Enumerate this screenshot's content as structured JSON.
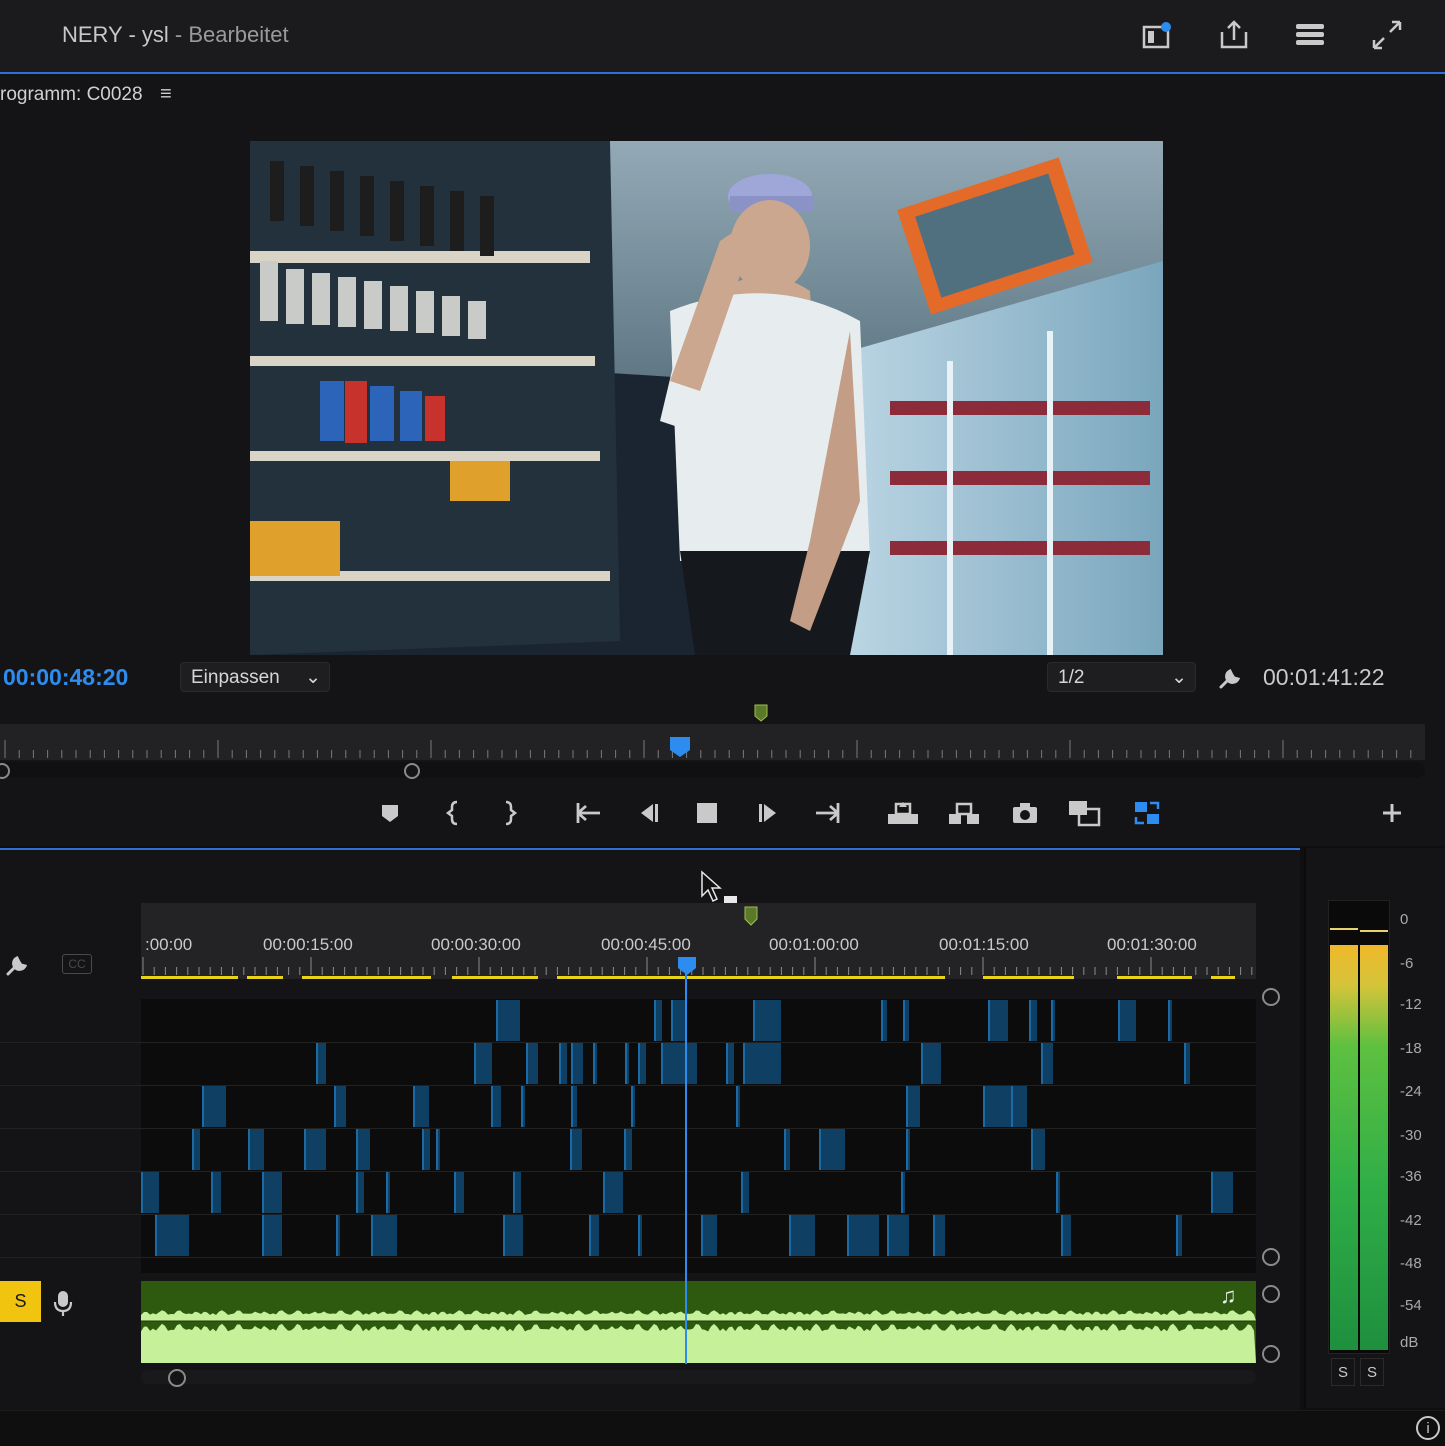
{
  "header": {
    "project": "NERY - ysl",
    "status": " - Bearbeitet",
    "icons": [
      "workspace-icon",
      "export-icon",
      "layout-icon",
      "fullscreen-icon"
    ]
  },
  "program": {
    "tab_label": "rogramm: C0028",
    "menu_glyph": "≡",
    "current_timecode": "00:00:48:20",
    "fit_label": "Einpassen",
    "resolution_label": "1/2",
    "duration_timecode": "00:01:41:22"
  },
  "timeline": {
    "ruler_labels": [
      ":00:00",
      "00:00:15:00",
      "00:00:30:00",
      "00:00:45:00",
      "00:01:00:00",
      "00:01:15:00",
      "00:01:30:00"
    ],
    "cc_label": "CC",
    "solo_label": "S",
    "music_glyph": "♫",
    "playhead_fraction": 0.489
  },
  "meters": {
    "scale": [
      "0",
      "-6",
      "-12",
      "-18",
      "-24",
      "-30",
      "-36",
      "-42",
      "-48",
      "-54",
      "dB"
    ],
    "solo_buttons": [
      "S",
      "S"
    ]
  },
  "colors": {
    "accent": "#2d8cf0",
    "clip": "#0f3f63",
    "audio": "#2d5a0e",
    "solo": "#f1c40f"
  }
}
